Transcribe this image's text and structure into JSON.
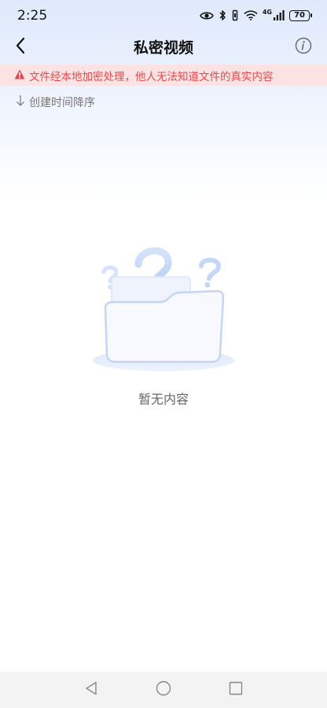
{
  "status_bar": {
    "time": "2:25",
    "network_label": "4G",
    "battery_level": "70",
    "icons": [
      "eye-icon",
      "bluetooth-icon",
      "vibrate-icon",
      "wifi-icon",
      "signal-icon",
      "battery-icon"
    ]
  },
  "header": {
    "title": "私密视频",
    "back_icon": "chevron-left-icon",
    "info_icon": "info-icon"
  },
  "warning": {
    "text": "文件经本地加密处理，他人无法知道文件的真实内容",
    "icon": "warning-triangle-icon",
    "color": "#e5484d",
    "background": "#fbe3e4"
  },
  "sort": {
    "label": "创建时间降序",
    "icon": "arrow-down-icon"
  },
  "empty_state": {
    "text": "暂无内容",
    "illustration": "empty-folder-question-icon"
  },
  "system_nav": {
    "icons": [
      "nav-back-icon",
      "nav-home-icon",
      "nav-recents-icon"
    ]
  }
}
